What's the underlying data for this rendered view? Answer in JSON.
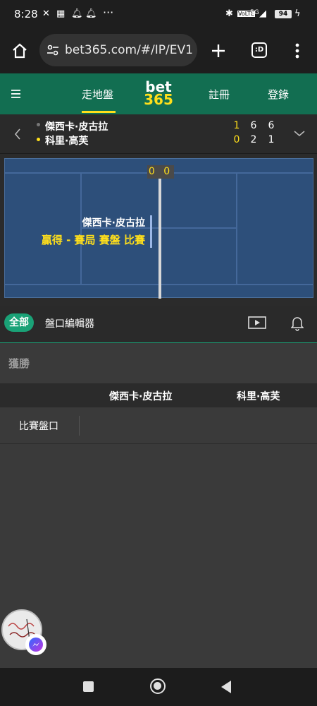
{
  "status_bar": {
    "time": "8:28",
    "battery": "94",
    "network": "5G"
  },
  "browser": {
    "url": "bet365.com/#/IP/EV1"
  },
  "header": {
    "tab_inplay": "走地盤",
    "logo_top": "bet",
    "logo_bottom": "365",
    "register": "註冊",
    "login": "登錄"
  },
  "scoreboard": {
    "players": [
      {
        "name": "傑西卡·皮古拉",
        "scores": [
          "1",
          "6",
          "6"
        ]
      },
      {
        "name": "科里·高芙",
        "scores": [
          "0",
          "2",
          "1"
        ]
      }
    ]
  },
  "court": {
    "point_score": "0 0",
    "player": "傑西卡·皮古拉",
    "status": "贏得 - 賽局 賽盤 比賽"
  },
  "filters": {
    "all": "全部",
    "market_editor": "盤口編輯器"
  },
  "market": {
    "title": "獲勝",
    "columns": [
      "傑西卡·皮古拉",
      "科里·高芙"
    ],
    "row_label": "比賽盤口"
  },
  "colors": {
    "brand_green": "#126e51",
    "accent_yellow": "#ffdf1b",
    "court_blue": "#2d4f7a"
  }
}
